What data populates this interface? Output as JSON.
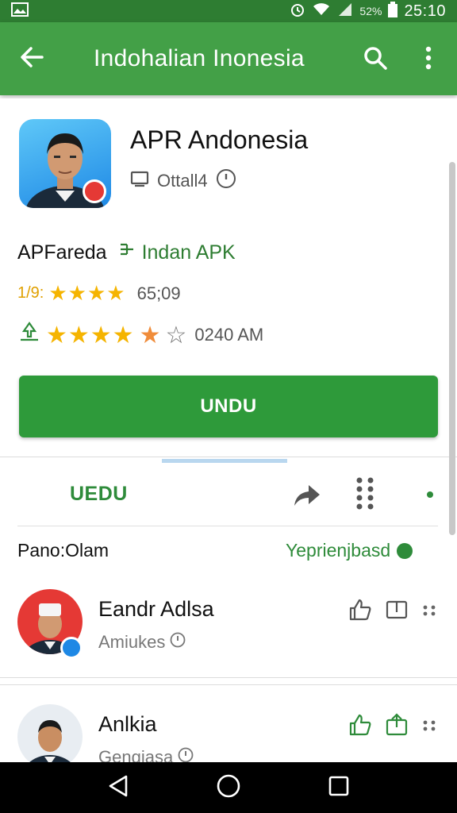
{
  "status_bar": {
    "battery_text": "52%",
    "time": "25:10"
  },
  "app_bar": {
    "title": "Indohalian Inonesia",
    "back_icon": "arrow-left-icon",
    "search_icon": "search-icon",
    "more_icon": "more-vertical-icon"
  },
  "app": {
    "name": "APR Andonesia",
    "meta": "Ottall4",
    "developer": "APFareda",
    "developer_link": "Indan APK",
    "rating_value": "1/9:",
    "rating_count": "65;09",
    "time": "0240 AM",
    "install_label": "UNDU"
  },
  "tabs": {
    "active_label": "UEDU",
    "section_title": "Pano:Olam",
    "section_link": "Yeprienjbasd"
  },
  "reviews": [
    {
      "name": "Eandr Adlsa",
      "subtitle": "Amiukes"
    },
    {
      "name": "Anlkia",
      "subtitle": "Gengiasa"
    }
  ],
  "colors": {
    "appbar": "#43a047",
    "statusbar": "#2e7d32",
    "accent": "#2e9a3a",
    "star": "#f5b400"
  }
}
